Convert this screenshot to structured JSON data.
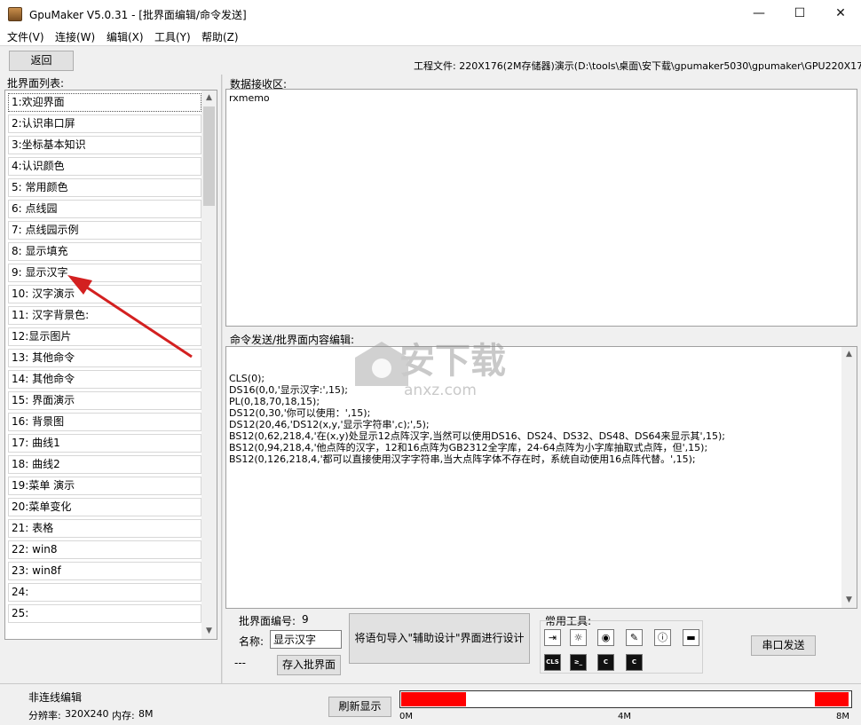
{
  "window": {
    "title": "GpuMaker V5.0.31 - [批界面编辑/命令发送]",
    "minimize_glyph": "—",
    "maximize_glyph": "☐",
    "close_glyph": "✕"
  },
  "menu": [
    "文件(V)",
    "连接(W)",
    "编辑(X)",
    "工具(Y)",
    "帮助(Z)"
  ],
  "toolbar": {
    "back_label": "返回",
    "project_file": "工程文件:  220X176(2M存储器)演示(D:\\tools\\桌面\\安下载\\gpumaker5030\\gpumaker\\GPU220X176_2M"
  },
  "left": {
    "label": "批界面列表:",
    "items": [
      "1:欢迎界面",
      "2:认识串口屏",
      "3:坐标基本知识",
      "4:认识颜色",
      "5: 常用颜色",
      "6: 点线园",
      "7: 点线园示例",
      "8: 显示填充",
      "9: 显示汉字",
      "10: 汉字演示",
      "11: 汉字背景色:",
      "12:显示图片",
      "13: 其他命令",
      "14: 其他命令",
      "15: 界面演示",
      "16: 背景图",
      "17: 曲线1",
      "18: 曲线2",
      "19:菜单 演示",
      "20:菜单变化",
      "21: 表格",
      "22: win8",
      "23: win8f",
      "24:",
      "25:"
    ],
    "selected_index": 0
  },
  "receive": {
    "label": "数据接收区:",
    "memo": "rxmemo"
  },
  "command": {
    "label": "命令发送/批界面内容编辑:",
    "lines": [
      "CLS(0);",
      "DS16(0,0,'显示汉字:',15);",
      "PL(0,18,70,18,15);",
      "DS12(0,30,'你可以使用：',15);",
      "DS12(20,46,'DS12(x,y,'显示字符串',c);',5);",
      "BS12(0,62,218,4,'在(x,y)处显示12点阵汉字,当然可以使用DS16、DS24、DS32、DS48、DS64来显示其',15);",
      "BS12(0,94,218,4,'他点阵的汉字，12和16点阵为GB2312全字库，24-64点阵为小字库抽取式点阵，但',15);",
      "BS12(0,126,218,4,'都可以直接使用汉字字符串,当大点阵字体不存在时，系统自动使用16点阵代替。',15);"
    ]
  },
  "bottom_panel": {
    "number_label": "批界面编号:",
    "number_value": "9",
    "name_label": "名称:",
    "name_value": "显示汉字",
    "dashes": "---",
    "save_label": "存入批界面",
    "import_label": "将语句导入\"辅助设计\"界面进行设计",
    "tools_label": "常用工具:",
    "tool_icons": [
      "enter-icon",
      "settings-icon",
      "target-icon",
      "pencil-icon",
      "info-icon",
      "memory-icon",
      "cls-icon",
      "terminal-icon",
      "c-icon",
      "c-icon"
    ],
    "tool_glyphs": [
      "⇥",
      "☼",
      "◉",
      "✎",
      "ⓘ",
      "▬",
      "CLS",
      "≥_",
      "C",
      "C"
    ],
    "send_label": "串口发送"
  },
  "status": {
    "mode": "非连线编辑",
    "resolution_label": "分辨率:",
    "resolution": "320X240",
    "memory_label": "内存:",
    "memory": "8M",
    "refresh_label": "刷新显示",
    "progress_ticks": [
      "0M",
      "4M",
      "8M"
    ],
    "used_segments": [
      [
        0.0,
        0.145
      ],
      [
        0.925,
        1.0
      ]
    ],
    "segment_color": "#ff0000"
  },
  "watermark": {
    "text_cn": "安下载",
    "text_en": "anxz.com"
  },
  "annotation": {
    "arrow_color": "#d32020"
  }
}
